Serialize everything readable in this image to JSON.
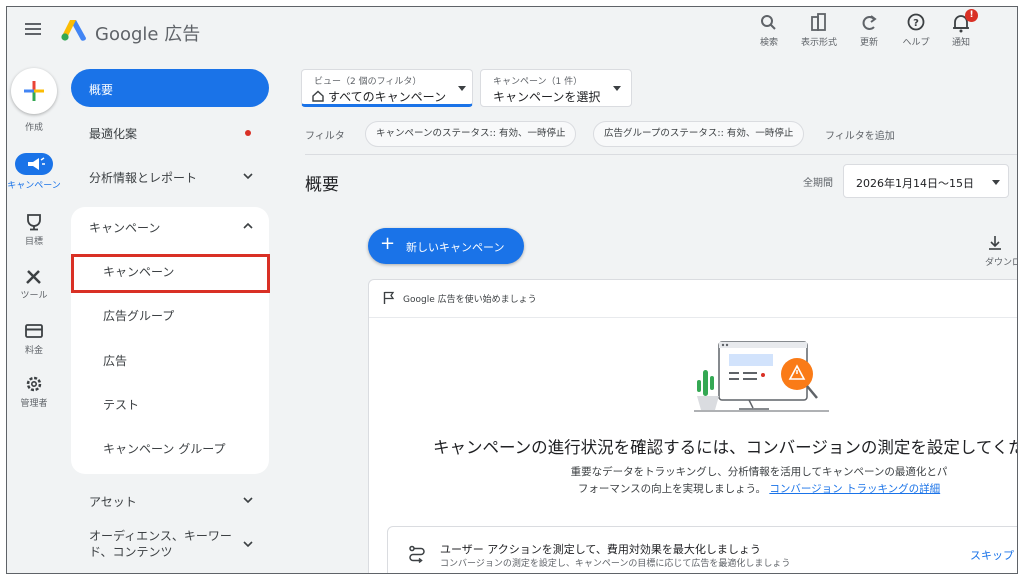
{
  "app": {
    "brand": "Google 広告",
    "accent": "#1a73e8",
    "alert_color": "#d93025"
  },
  "toolbar": [
    {
      "icon": "search-icon",
      "label": "検索"
    },
    {
      "icon": "display-format-icon",
      "label": "表示形式"
    },
    {
      "icon": "refresh-icon",
      "label": "更新"
    },
    {
      "icon": "help-icon",
      "label": "ヘルプ"
    },
    {
      "icon": "bell-icon",
      "label": "通知",
      "badge": "!"
    }
  ],
  "rail": {
    "create": "作成",
    "campaigns": "キャンペーン",
    "goals": "目標",
    "tools": "ツール",
    "billing": "料金",
    "admin": "管理者"
  },
  "nav": {
    "overview": "概要",
    "recommendations": "最適化案",
    "insights": "分析情報とレポート",
    "campaigns_section": "キャンペーン",
    "sub_items": [
      "キャンペーン",
      "広告グループ",
      "広告",
      "テスト",
      "キャンペーン グループ"
    ],
    "assets": "アセット",
    "audiences": "オーディエンス、キーワー",
    "audiences_line2": "ド、コンテンツ"
  },
  "filters": {
    "view_small": "ビュー（2 個のフィルタ）",
    "view_main": "すべてのキャンペーン",
    "campaign_small": "キャンペーン（1 件）",
    "campaign_main": "キャンペーンを選択",
    "filter_label": "フィルタ",
    "chips": [
      "キャンペーンのステータス:: 有効、一時停止",
      "広告グループのステータス:: 有効、一時停止"
    ],
    "add_filter": "フィルタを追加"
  },
  "main": {
    "title": "概要",
    "period_label": "全期間",
    "date_range": "2026年1月14日〜15日",
    "new_campaign": "新しいキャンペーン",
    "download": "ダウンロード"
  },
  "card": {
    "header": "Google 広告を使い始めましょう",
    "headline": "キャンペーンの進行状況を確認するには、コンバージョンの測定を設定してください",
    "desc_line1": "重要なデータをトラッキングし、分析情報を活用してキャンペーンの最適化とパ",
    "desc_line2": "フォーマンスの向上を実現しましょう。",
    "desc_link": "コンバージョン トラッキングの詳細",
    "inner_title": "ユーザー アクションを測定して、費用対効果を最大化しましょう",
    "inner_sub": "コンバージョンの測定を設定し、キャンペーンの目標に応じて広告を最適化しましょう",
    "skip": "スキップ"
  }
}
